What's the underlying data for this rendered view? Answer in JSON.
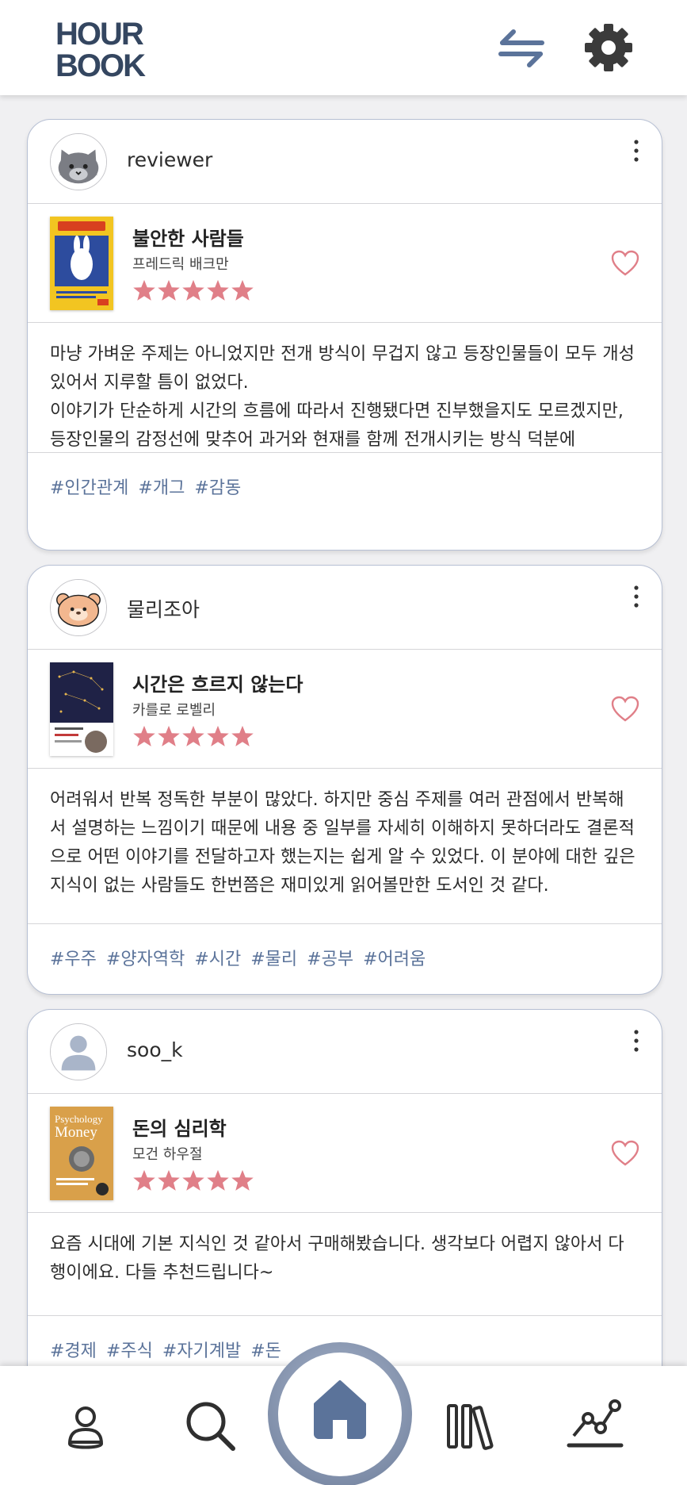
{
  "app": {
    "logo_line1": "HOUR",
    "logo_line2": "BOOK",
    "icons": [
      "swap-icon",
      "gear-icon"
    ]
  },
  "colors": {
    "brand": "#344660",
    "accent": "#5b739a",
    "star": "#e07f88",
    "heart": "#e07f88"
  },
  "posts": [
    {
      "username": "reviewer",
      "avatar": "cat",
      "book_title": "불안한 사람들",
      "author": "프레드릭 배크만",
      "rating": 5,
      "review": "마냥 가벼운 주제는 아니었지만 전개 방식이 무겁지 않고 등장인물들이 모두 개성 있어서 지루할 틈이 없었다.\n이야기가 단순하게 시간의 흐름에 따라서 진행됐다면 진부했을지도 모르겠지만, 등장인물의 감정선에 맞추어 과거와 현재를 함께 전개시키는 방식 덕분에",
      "tags": [
        "#인간관계",
        "#개그",
        "#감동"
      ]
    },
    {
      "username": "물리조아",
      "avatar": "hamster",
      "book_title": "시간은 흐르지 않는다",
      "author": "카를로 로벨리",
      "rating": 5,
      "review": "어려워서 반복 정독한 부분이 많았다. 하지만 중심 주제를 여러 관점에서 반복해서 설명하는 느낌이기 때문에 내용 중 일부를 자세히 이해하지 못하더라도 결론적으로 어떤 이야기를 전달하고자 했는지는 쉽게 알 수 있었다. 이 분야에 대한 깊은 지식이 없는 사람들도 한번쯤은 재미있게 읽어볼만한 도서인 것 같다.",
      "tags": [
        "#우주",
        "#양자역학",
        "#시간",
        "#물리",
        "#공부",
        "#어려움"
      ]
    },
    {
      "username": "soo_k",
      "avatar": "default",
      "book_title": "돈의 심리학",
      "author": "모건 하우절",
      "rating": 5,
      "review": "요즘 시대에 기본 지식인 것 같아서 구매해봤습니다. 생각보다 어렵지 않아서 다행이에요. 다들 추천드립니다~",
      "tags": [
        "#경제",
        "#주식",
        "#자기계발",
        "#돈"
      ]
    }
  ],
  "bottom_nav": [
    "profile-icon",
    "search-icon",
    "home-icon",
    "library-icon",
    "stats-icon"
  ]
}
